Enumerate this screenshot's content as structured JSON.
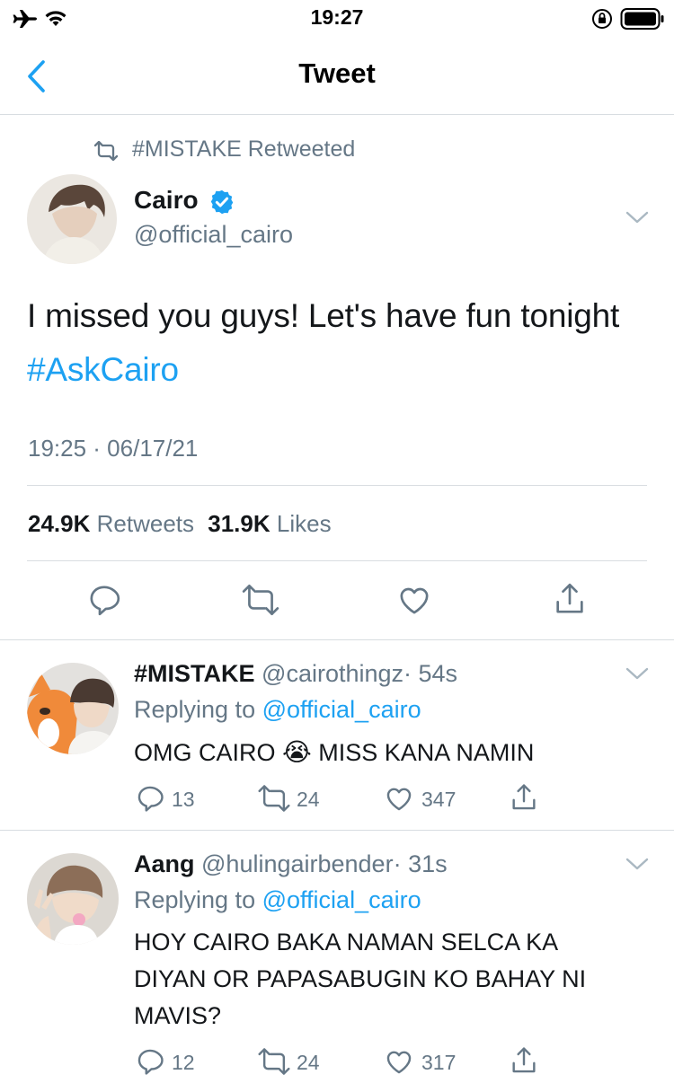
{
  "status_bar": {
    "time": "19:27"
  },
  "header": {
    "title": "Tweet"
  },
  "tweet": {
    "retweet_banner": "#MISTAKE Retweeted",
    "name": "Cairo",
    "handle": "@official_cairo",
    "text": "I missed you guys! Let's have fun tonight ",
    "hashtag": "#AskCairo",
    "timestamp": "19:25 · 06/17/21",
    "retweets_count": "24.9K",
    "retweets_label": "Retweets",
    "likes_count": "31.9K",
    "likes_label": "Likes"
  },
  "replies": [
    {
      "name": "#MISTAKE",
      "handle": "@cairothingz",
      "time": "· 54s",
      "replying_prefix": "Replying to",
      "replying_to": "@official_cairo",
      "text_before_emoji": "OMG CAIRO",
      "emoji": "😭",
      "text_after_emoji": "MISS KANA NAMIN",
      "reply_count": "13",
      "retweet_count": "24",
      "like_count": "347"
    },
    {
      "name": "Aang",
      "handle": "@hulingairbender",
      "time": "· 31s",
      "replying_prefix": "Replying to",
      "replying_to": "@official_cairo",
      "text_line1": "HOY CAIRO BAKA NAMAN SELCA KA",
      "text_line2": "DIYAN OR PAPASABUGIN KO BAHAY NI",
      "text_line3": "MAVIS?",
      "reply_count": "12",
      "retweet_count": "24",
      "like_count": "317"
    }
  ],
  "icons": {
    "airplane": "airplane-icon",
    "wifi": "wifi-icon",
    "orientation_lock": "orientation-lock-icon",
    "battery": "battery-icon",
    "back": "back-chevron-icon",
    "verified": "verified-badge-icon",
    "reply": "reply-icon",
    "retweet": "retweet-icon",
    "like": "heart-icon",
    "share": "share-icon",
    "more": "chevron-down-icon"
  },
  "colors": {
    "accent": "#1da1f2",
    "text": "#14171a",
    "secondary": "#657786",
    "divider": "#d8dde1"
  }
}
